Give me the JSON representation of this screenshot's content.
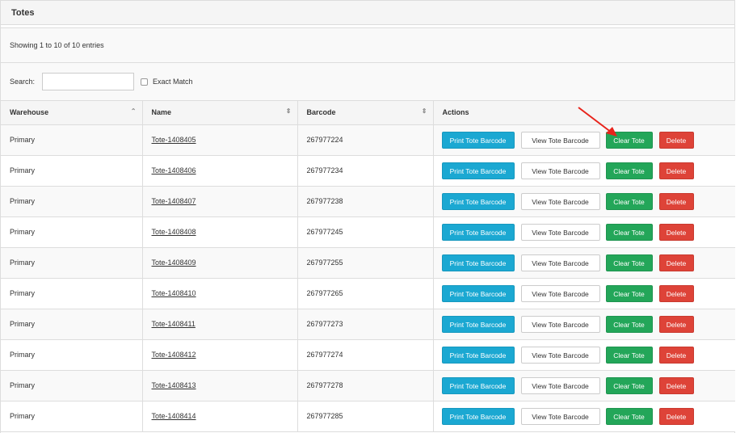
{
  "panel": {
    "title": "Totes"
  },
  "info": {
    "text": "Showing 1 to 10 of 10 entries"
  },
  "search": {
    "label": "Search:",
    "value": "",
    "exact_match_label": "Exact Match",
    "exact_match_checked": false
  },
  "table": {
    "headers": {
      "warehouse": "Warehouse",
      "name": "Name",
      "barcode": "Barcode",
      "actions": "Actions"
    },
    "rows": [
      {
        "warehouse": "Primary",
        "name": "Tote-1408405",
        "barcode": "267977224"
      },
      {
        "warehouse": "Primary",
        "name": "Tote-1408406",
        "barcode": "267977234"
      },
      {
        "warehouse": "Primary",
        "name": "Tote-1408407",
        "barcode": "267977238"
      },
      {
        "warehouse": "Primary",
        "name": "Tote-1408408",
        "barcode": "267977245"
      },
      {
        "warehouse": "Primary",
        "name": "Tote-1408409",
        "barcode": "267977255"
      },
      {
        "warehouse": "Primary",
        "name": "Tote-1408410",
        "barcode": "267977265"
      },
      {
        "warehouse": "Primary",
        "name": "Tote-1408411",
        "barcode": "267977273"
      },
      {
        "warehouse": "Primary",
        "name": "Tote-1408412",
        "barcode": "267977274"
      },
      {
        "warehouse": "Primary",
        "name": "Tote-1408413",
        "barcode": "267977278"
      },
      {
        "warehouse": "Primary",
        "name": "Tote-1408414",
        "barcode": "267977285"
      }
    ],
    "actions": {
      "print": "Print Tote Barcode",
      "view": "View Tote Barcode",
      "clear": "Clear Tote",
      "delete": "Delete"
    },
    "sort_icons": {
      "warehouse": "chevron-up-icon",
      "other": "sort-icon"
    }
  },
  "colors": {
    "print_button": "#1ba8d2",
    "clear_button": "#23a659",
    "delete_button": "#de4338",
    "annotation_arrow": "#e8231b"
  }
}
